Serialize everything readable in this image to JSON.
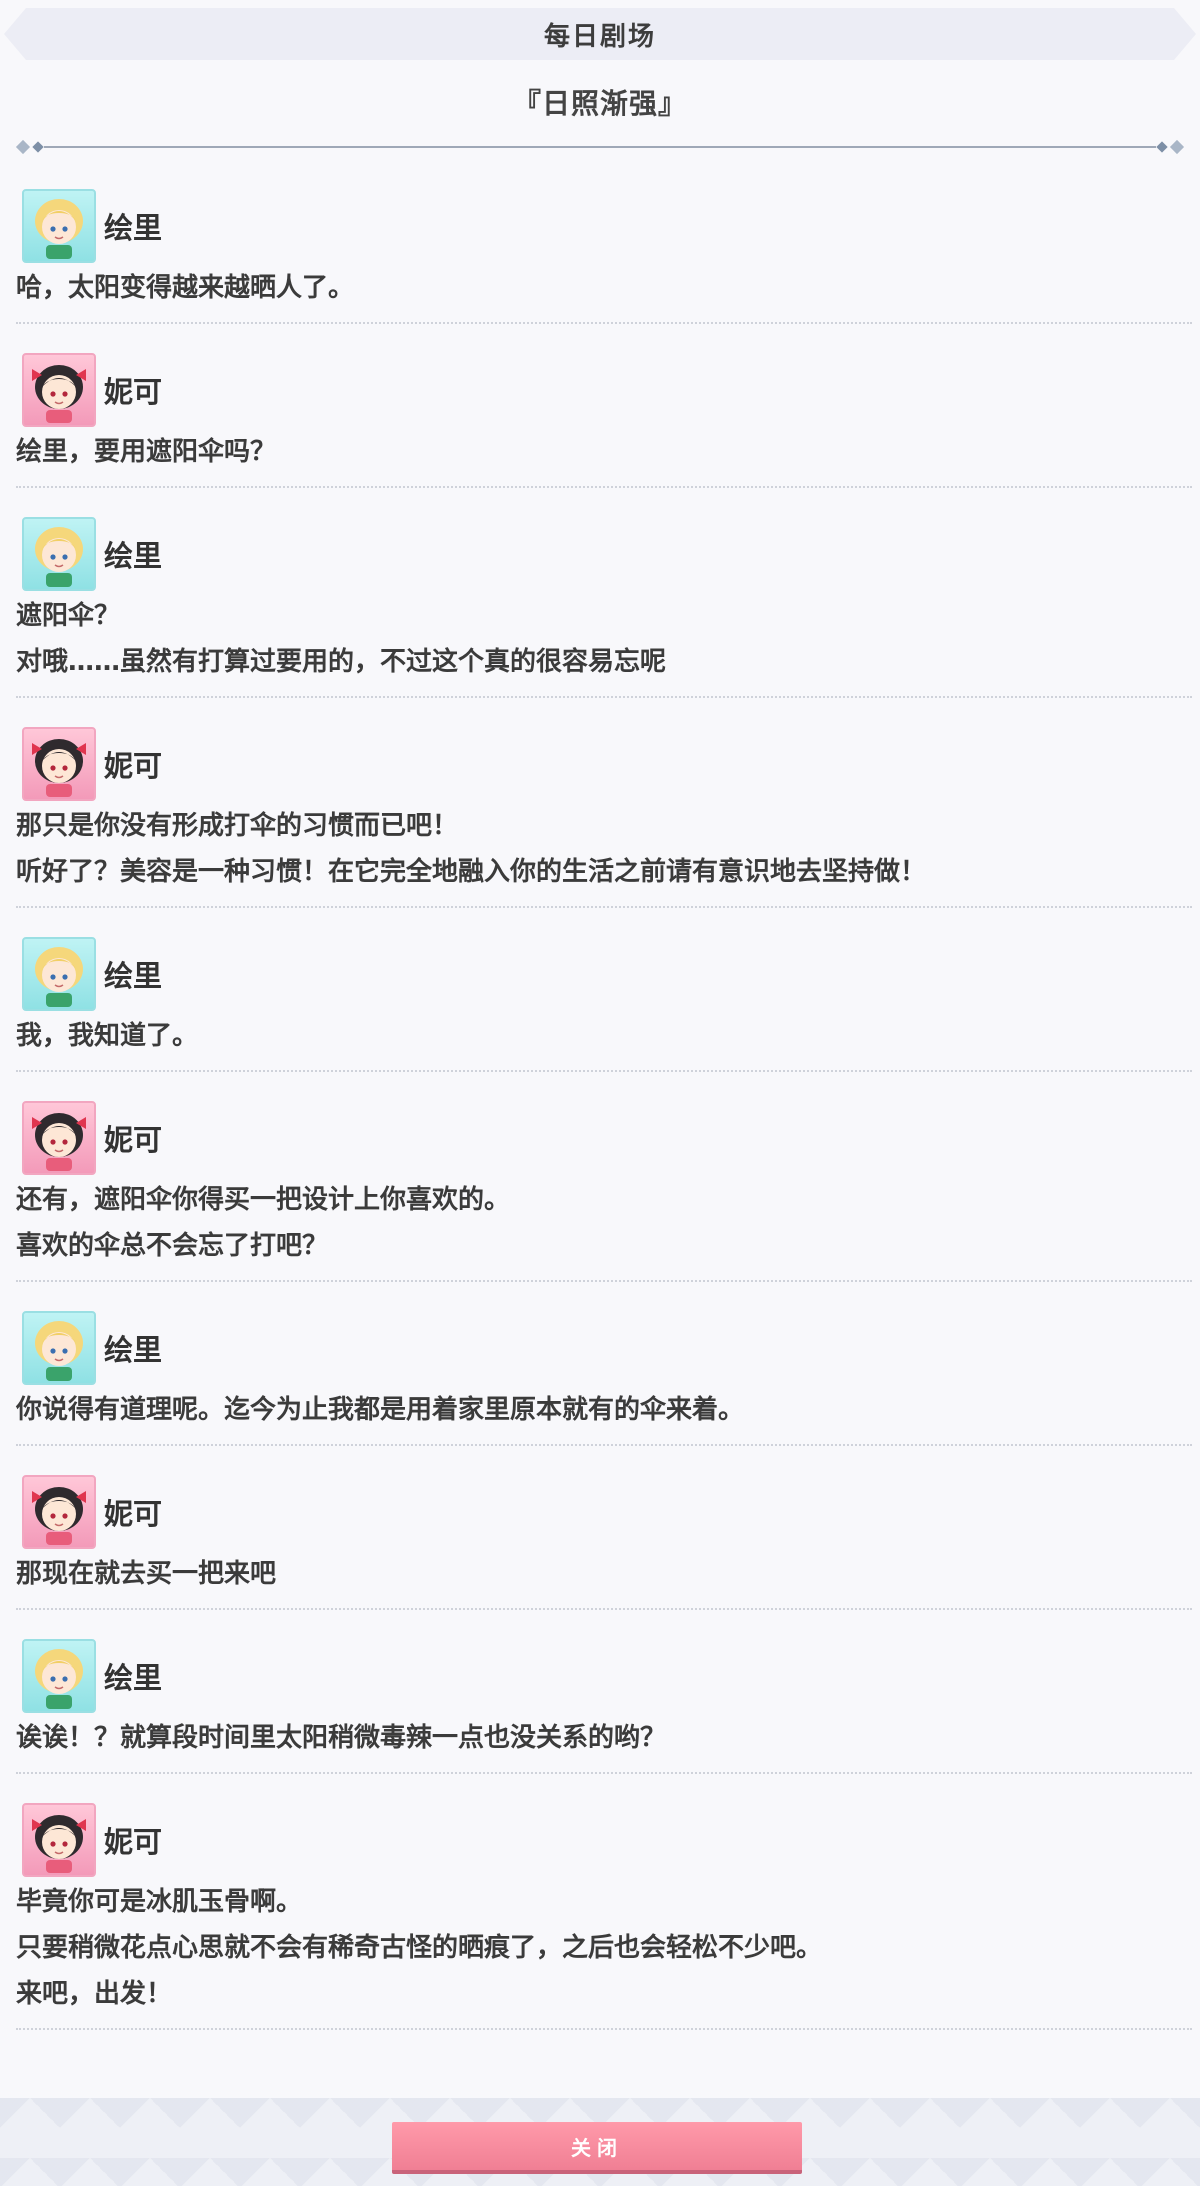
{
  "header": {
    "title": "每日剧场"
  },
  "episode": {
    "title": "『日照渐强』"
  },
  "entries": [
    {
      "speaker": "绘里",
      "avatar": "eli-avatar",
      "avatar_color": "blue",
      "lines": [
        "哈，太阳变得越来越晒人了。"
      ]
    },
    {
      "speaker": "妮可",
      "avatar": "nico-avatar",
      "avatar_color": "pink",
      "lines": [
        "绘里，要用遮阳伞吗？"
      ]
    },
    {
      "speaker": "绘里",
      "avatar": "eli-avatar",
      "avatar_color": "blue",
      "lines": [
        "遮阳伞？",
        "对哦……虽然有打算过要用的，不过这个真的很容易忘呢"
      ]
    },
    {
      "speaker": "妮可",
      "avatar": "nico-avatar",
      "avatar_color": "pink",
      "lines": [
        "那只是你没有形成打伞的习惯而已吧！",
        "听好了？美容是一种习惯！在它完全地融入你的生活之前请有意识地去坚持做！"
      ]
    },
    {
      "speaker": "绘里",
      "avatar": "eli-avatar",
      "avatar_color": "blue",
      "lines": [
        "我，我知道了。"
      ]
    },
    {
      "speaker": "妮可",
      "avatar": "nico-avatar",
      "avatar_color": "pink",
      "lines": [
        "还有，遮阳伞你得买一把设计上你喜欢的。",
        "喜欢的伞总不会忘了打吧？"
      ]
    },
    {
      "speaker": "绘里",
      "avatar": "eli-avatar",
      "avatar_color": "blue",
      "lines": [
        "你说得有道理呢。迄今为止我都是用着家里原本就有的伞来着。"
      ]
    },
    {
      "speaker": "妮可",
      "avatar": "nico-avatar",
      "avatar_color": "pink",
      "lines": [
        "那现在就去买一把来吧"
      ]
    },
    {
      "speaker": "绘里",
      "avatar": "eli-avatar",
      "avatar_color": "blue",
      "lines": [
        "诶诶！？就算段时间里太阳稍微毒辣一点也没关系的哟？"
      ]
    },
    {
      "speaker": "妮可",
      "avatar": "nico-avatar",
      "avatar_color": "pink",
      "lines": [
        "毕竟你可是冰肌玉骨啊。",
        "只要稍微花点心思就不会有稀奇古怪的晒痕了，之后也会轻松不少吧。",
        "来吧，出发！"
      ]
    }
  ],
  "footer": {
    "close_label": "关闭"
  }
}
